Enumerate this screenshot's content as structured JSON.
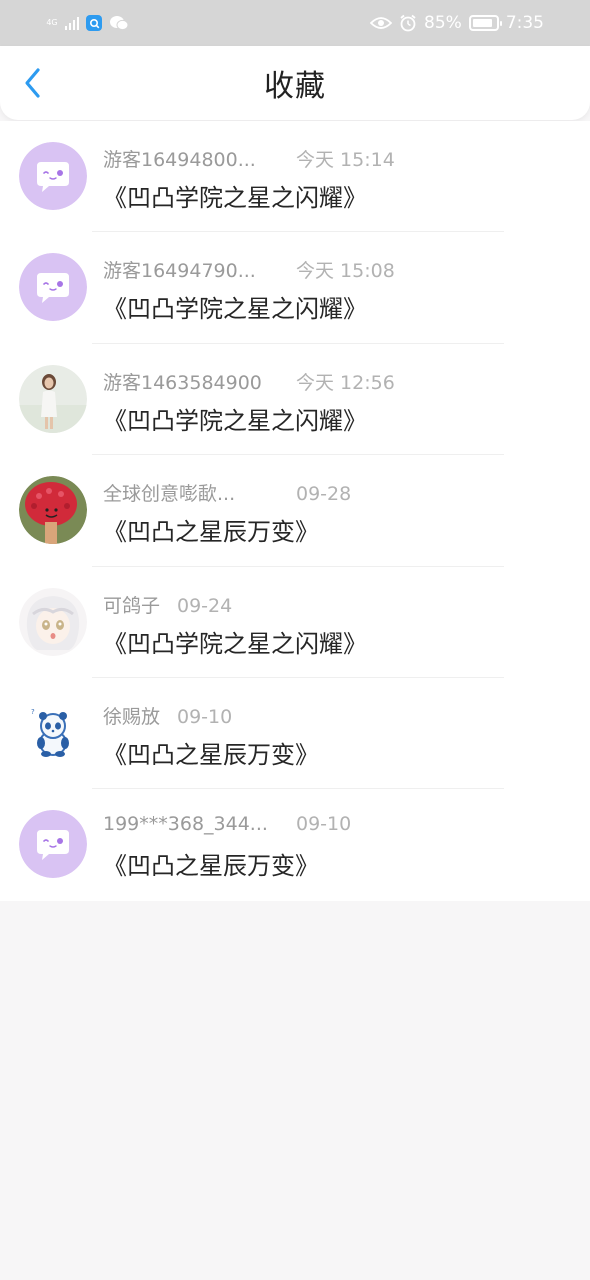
{
  "status_bar": {
    "network": "4G",
    "battery": "85%",
    "battery_level": 0.85,
    "time": "7:35",
    "icons": [
      "signal-icon",
      "app-badge-icon",
      "wechat-icon",
      "eye-icon",
      "alarm-icon",
      "battery-icon"
    ]
  },
  "header": {
    "title": "收藏",
    "back_icon": "chevron-left-icon",
    "accent": "#2d9bf0"
  },
  "items": [
    {
      "user": "游客16494800...",
      "time": "今天 15:14",
      "title": "《凹凸学院之星之闪耀》",
      "avatar": "chat-bubble-avatar"
    },
    {
      "user": "游客16494790...",
      "time": "今天 15:08",
      "title": "《凹凸学院之星之闪耀》",
      "avatar": "chat-bubble-avatar"
    },
    {
      "user": "游客1463584900",
      "time": "今天 12:56",
      "title": "《凹凸学院之星之闪耀》",
      "avatar": "girl-photo-avatar"
    },
    {
      "user": "全球创意嘭歃...",
      "time": "09-28",
      "title": "《凹凸之星辰万变》",
      "avatar": "raspberry-avatar"
    },
    {
      "user": "可鸽子",
      "time": "09-24",
      "title": "《凹凸学院之星之闪耀》",
      "avatar": "anime-girl-avatar"
    },
    {
      "user": "徐赐放",
      "time": "09-10",
      "title": "《凹凸之星辰万变》",
      "avatar": "panda-avatar"
    },
    {
      "user": "199***368_344...",
      "time": "09-10",
      "title": "《凹凸之星辰万变》",
      "avatar": "chat-bubble-avatar"
    }
  ],
  "colors": {
    "chat_avatar_bg": "#d9c3f3",
    "chat_avatar_glyph": "#ffffff",
    "chat_avatar_dot": "#a775e6"
  }
}
